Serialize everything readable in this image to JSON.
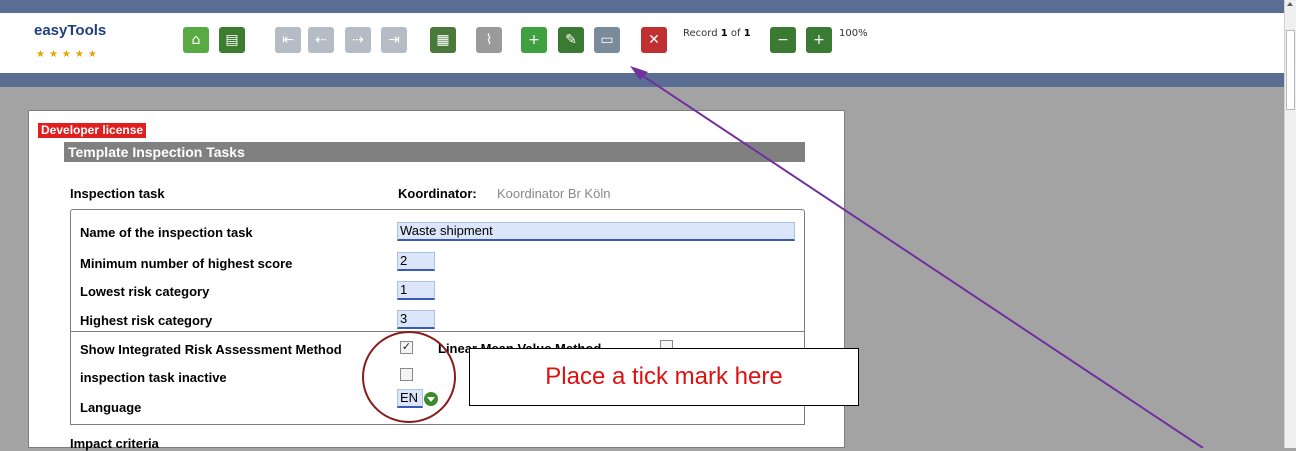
{
  "app": {
    "logo": "easyTools",
    "stars": "★★★★★"
  },
  "toolbar": {
    "icons": [
      {
        "name": "home-icon",
        "glyph": "⌂",
        "bg": "#5aaa44"
      },
      {
        "name": "list-icon",
        "glyph": "▤",
        "bg": "#3d7d30"
      },
      {
        "name": "first-record-icon",
        "glyph": "⇤",
        "bg": "#b5bcc6"
      },
      {
        "name": "previous-record-icon",
        "glyph": "⇠",
        "bg": "#b5bcc6"
      },
      {
        "name": "next-record-icon",
        "glyph": "⇢",
        "bg": "#b5bcc6"
      },
      {
        "name": "last-record-icon",
        "glyph": "⇥",
        "bg": "#b5bcc6"
      },
      {
        "name": "pdf-icon",
        "glyph": "▦",
        "bg": "#4a7a3a"
      },
      {
        "name": "attachment-icon",
        "glyph": "⌇",
        "bg": "#9a9a9a"
      },
      {
        "name": "new-record-icon",
        "glyph": "+",
        "bg": "#3ea040"
      },
      {
        "name": "edit-record-icon",
        "glyph": "✎",
        "bg": "#3a7a32"
      },
      {
        "name": "save-icon",
        "glyph": "▭",
        "bg": "#7a8c9a"
      },
      {
        "name": "delete-icon",
        "glyph": "✕",
        "bg": "#c03030"
      },
      {
        "name": "zoom-out-icon",
        "glyph": "−",
        "bg": "#3a7a32"
      },
      {
        "name": "zoom-in-icon",
        "glyph": "+",
        "bg": "#3a7a32"
      }
    ],
    "record_prefix": "Record ",
    "record_current": "1",
    "record_of": " of ",
    "record_total": "1",
    "zoom": "100%"
  },
  "form": {
    "developer_license": "Developer license",
    "section_title": "Template Inspection Tasks",
    "inspection_task_label": "Inspection task",
    "koordinator_label": "Koordinator:",
    "koordinator_value": "Koordinator Br Köln",
    "fields": {
      "name_label": "Name of the inspection task",
      "name_value": "Waste shipment",
      "min_score_label": "Minimum number of highest score",
      "min_score_value": "2",
      "lowest_risk_label": "Lowest risk category",
      "lowest_risk_value": "1",
      "highest_risk_label": "Highest risk category",
      "highest_risk_value": "3",
      "show_integrated_label": "Show Integrated Risk Assessment Method",
      "show_integrated_checked": true,
      "linear_mean_label": "Linear Mean Value Method",
      "linear_mean_checked": false,
      "inactive_label": "inspection task inactive",
      "inactive_checked": false,
      "language_label": "Language",
      "language_value": "EN"
    },
    "impact_criteria_label": "Impact criteria"
  },
  "annotation": {
    "callout_text": "Place a tick mark here",
    "ellipse_color": "#8b1a1a",
    "arrow_color": "#7030a0"
  }
}
